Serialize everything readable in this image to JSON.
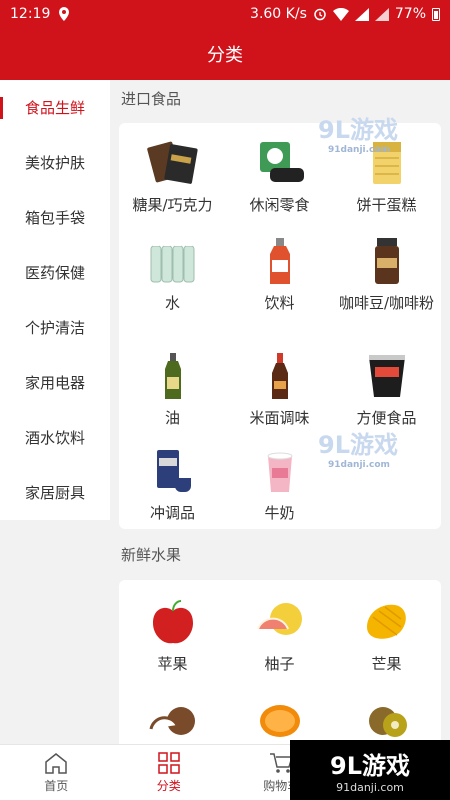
{
  "status": {
    "time": "12:19",
    "speed": "3.60 K/s",
    "battery": "77%"
  },
  "header": {
    "title": "分类"
  },
  "sidebar": {
    "items": [
      "食品生鲜",
      "美妆护肤",
      "箱包手袋",
      "医药保健",
      "个护清洁",
      "家用电器",
      "酒水饮料",
      "家居厨具"
    ]
  },
  "sections": [
    {
      "title": "进口食品",
      "items": [
        "糖果/巧克力",
        "休闲零食",
        "饼干蛋糕",
        "水",
        "饮料",
        "咖啡豆/咖啡粉",
        "油",
        "米面调味",
        "方便食品",
        "冲调品",
        "牛奶"
      ]
    },
    {
      "title": "新鲜水果",
      "items": [
        "苹果",
        "柚子",
        "芒果"
      ]
    }
  ],
  "tabs": [
    "首页",
    "分类",
    "购物车"
  ],
  "watermark": {
    "brand": "9L游戏",
    "site": "91danji.com"
  },
  "colors": {
    "accent": "#d0121b"
  }
}
